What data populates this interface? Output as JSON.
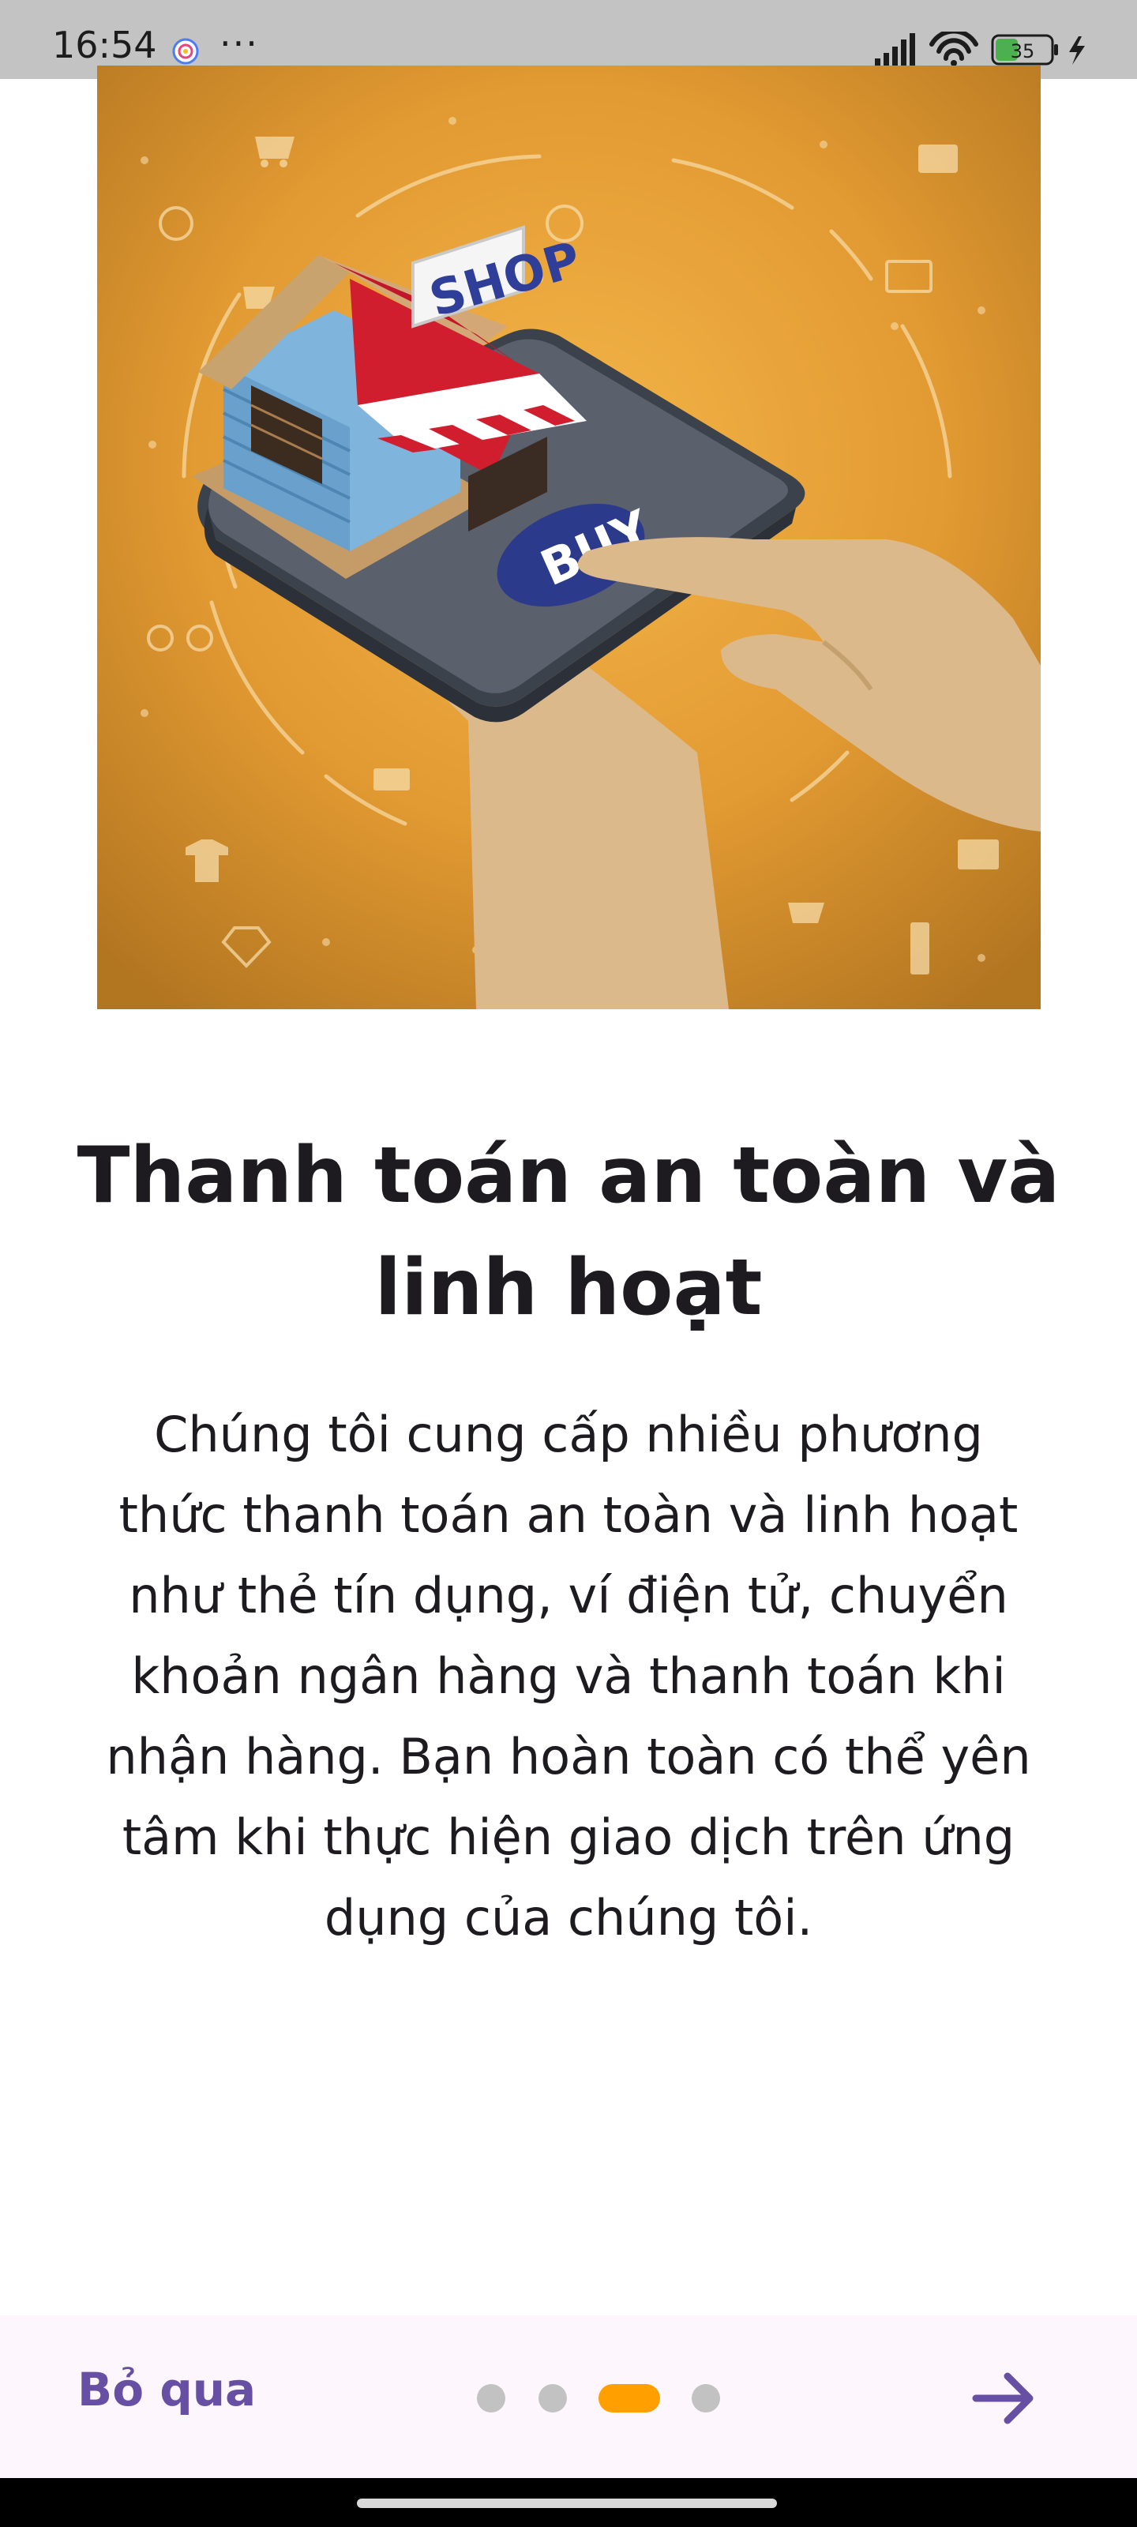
{
  "status_bar": {
    "time": "16:54",
    "more": "···",
    "battery": "35"
  },
  "onboarding": {
    "title": "Thanh toán an toàn và linh hoạt",
    "description": "Chúng tôi cung cấp nhiều phương thức thanh toán an toàn và linh hoạt như thẻ tín dụng, ví điện tử, chuyển khoản ngân hàng và thanh toán khi nhận hàng. Bạn hoàn toàn có thể yên tâm khi thực hiện giao dịch trên ứng dụng của chúng tôi.",
    "illustration": {
      "sign_text": "SHOP",
      "button_text": "BUY"
    }
  },
  "bottom_bar": {
    "skip_label": "Bỏ qua",
    "page_count": 4,
    "current_page": 3,
    "next_icon": "arrow-right-icon"
  },
  "colors": {
    "accent": "#6750a4",
    "indicator_active": "#ff9f00",
    "indicator_inactive": "#c2c2c2",
    "hero_background": "#e9a23a"
  }
}
